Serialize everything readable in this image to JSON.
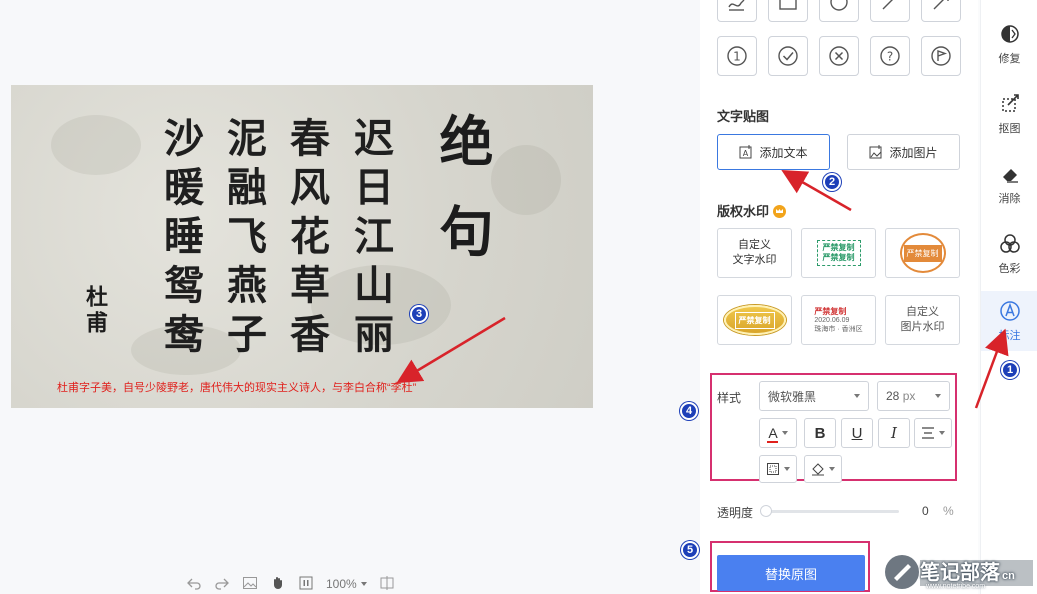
{
  "image": {
    "poem_title": "绝句",
    "poem_columns": [
      "迟日江山丽",
      "春风花草香",
      "泥融飞燕子",
      "沙暖睡鸳鸯"
    ],
    "poem_author": "杜甫",
    "caption": "杜甫字子美，自号少陵野老，唐代伟大的现实主义诗人，与李白合称“李杜”"
  },
  "bottom_toolbar": {
    "zoom": "100%"
  },
  "panel": {
    "text_sticker_title": "文字贴图",
    "add_text": "添加文本",
    "add_image": "添加图片",
    "copyright_title": "版权水印",
    "watermarks": {
      "custom_text": "自定义\n文字水印",
      "green_line1": "严禁复制",
      "green_line2": "严禁复制",
      "orange_circle": "严禁复制",
      "gold_oval": "严禁复制",
      "location_title": "严禁复制",
      "location_date": "2020.06.09",
      "location_place": "珠海市 · 香洲区",
      "custom_image": "自定义\n图片水印"
    },
    "style_label": "样式",
    "font": "微软雅黑",
    "size_value": "28",
    "size_unit": "px",
    "opacity_label": "透明度",
    "opacity_value": "0",
    "opacity_unit": "%",
    "replace_button": "替换原图"
  },
  "sidebar": {
    "items": [
      {
        "label": "修复",
        "icon": "repair-icon"
      },
      {
        "label": "抠图",
        "icon": "cutout-icon"
      },
      {
        "label": "消除",
        "icon": "eraser-icon"
      },
      {
        "label": "色彩",
        "icon": "color-icon"
      },
      {
        "label": "标注",
        "icon": "annotate-icon"
      }
    ]
  },
  "annotations": [
    "1",
    "2",
    "3",
    "4",
    "5"
  ],
  "site_watermark": {
    "main": "笔记部落",
    "suffix": "cn",
    "url": "www.notetribe.com"
  },
  "colors": {
    "accent": "#3a78e0",
    "highlight_box": "#d6306f",
    "arrow": "#d8232a",
    "badge": "#1d3fb8",
    "caption": "#e0201c"
  }
}
